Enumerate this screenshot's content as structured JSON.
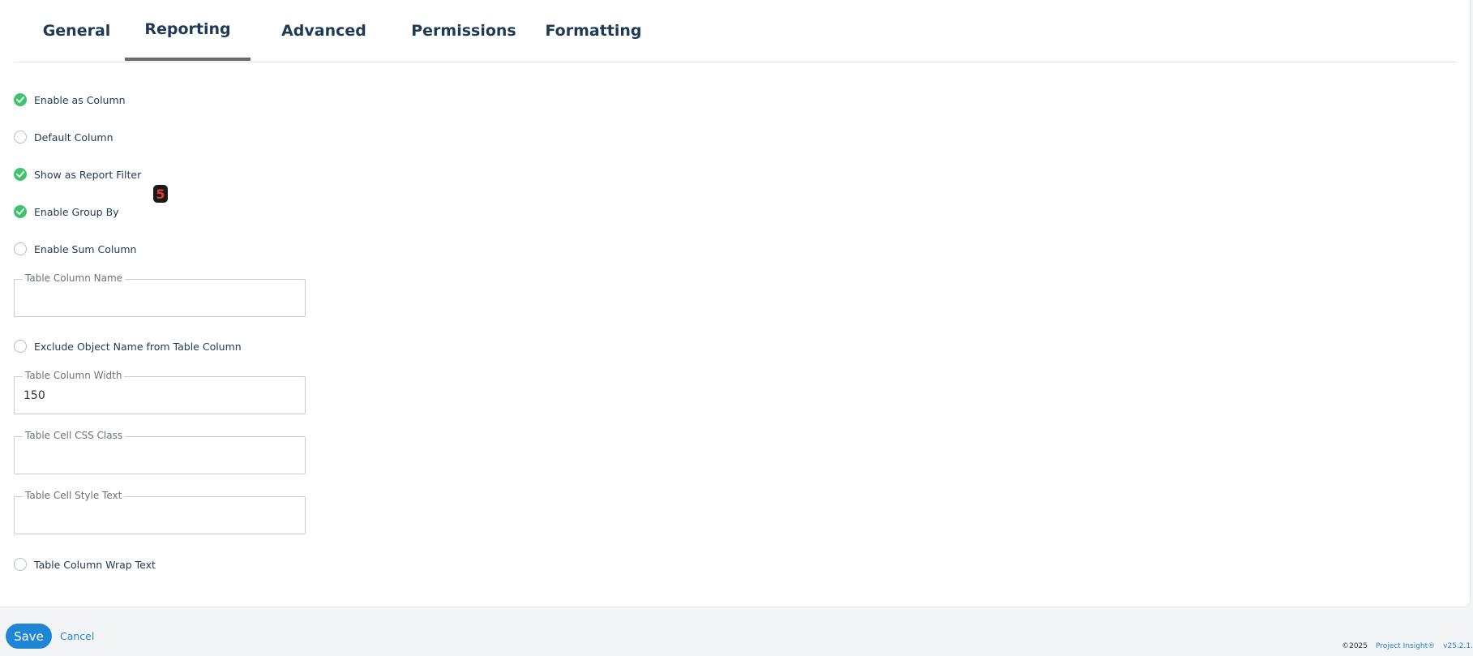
{
  "tabs": [
    {
      "label": "General",
      "active": false
    },
    {
      "label": "Reporting",
      "active": true
    },
    {
      "label": "Advanced",
      "active": false
    },
    {
      "label": "Permissions",
      "active": false
    },
    {
      "label": "Formatting",
      "active": false
    }
  ],
  "options": {
    "enable_as_column": {
      "label": "Enable as Column",
      "checked": true
    },
    "default_column": {
      "label": "Default Column",
      "checked": false
    },
    "show_as_report_filter": {
      "label": "Show as Report Filter",
      "checked": true
    },
    "enable_group_by": {
      "label": "Enable Group By",
      "checked": true
    },
    "enable_sum_column": {
      "label": "Enable Sum Column",
      "checked": false
    },
    "exclude_object_name": {
      "label": "Exclude Object Name from Table Column",
      "checked": false
    },
    "table_column_wrap_text": {
      "label": "Table Column Wrap Text",
      "checked": false
    }
  },
  "fields": {
    "table_column_name": {
      "label": "Table Column Name",
      "value": ""
    },
    "table_column_width": {
      "label": "Table Column Width",
      "value": "150"
    },
    "table_cell_css_class": {
      "label": "Table Cell CSS Class",
      "value": ""
    },
    "table_cell_style_text": {
      "label": "Table Cell Style Text",
      "value": ""
    }
  },
  "marker": {
    "text": "5"
  },
  "actions": {
    "save_label": "Save",
    "cancel_label": "Cancel"
  },
  "footer": {
    "copyright": "©2025",
    "brand": "Project Insight®",
    "version": "v25.2.1."
  },
  "colors": {
    "check_on": "#3ec46d",
    "primary": "#1f86d6",
    "text": "#1e3a56"
  },
  "icons": {
    "check": "checkmark-icon"
  }
}
